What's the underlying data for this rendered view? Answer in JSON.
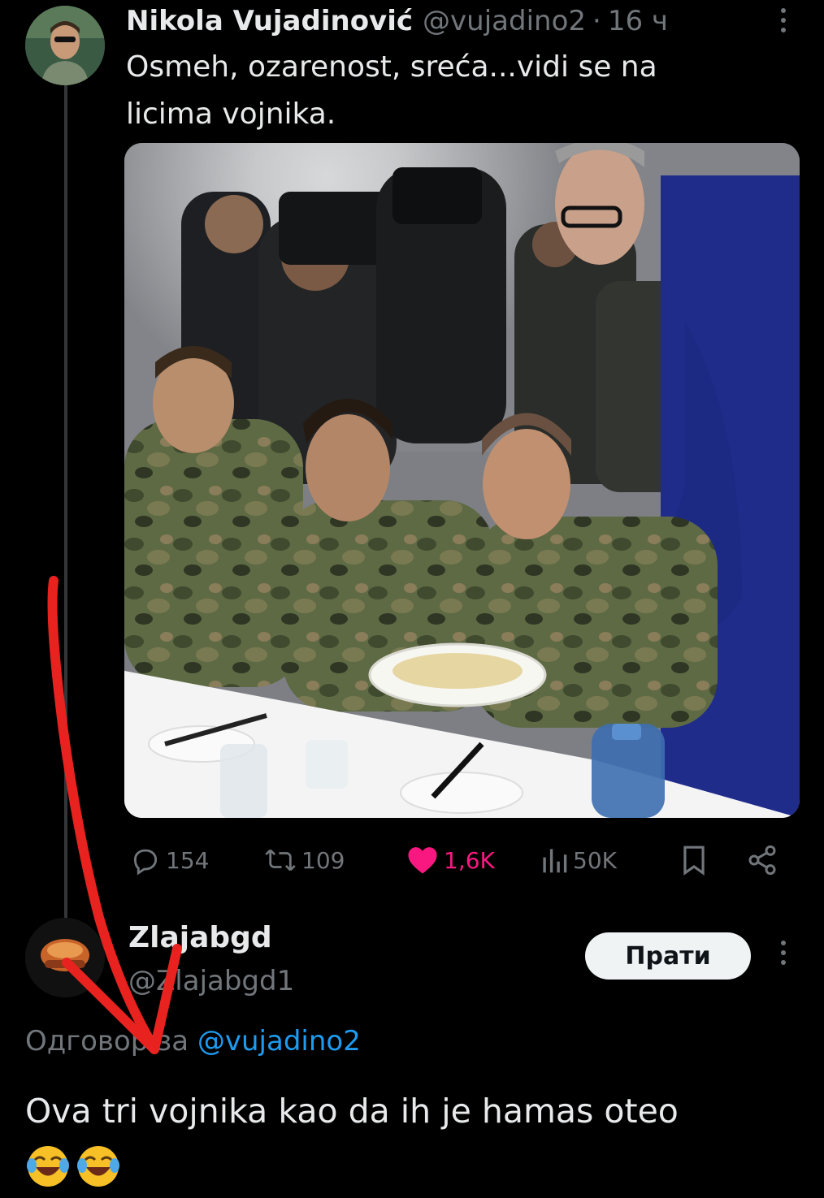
{
  "tweet": {
    "author_name": "Nikola Vujadinović",
    "handle": "@vujadino2",
    "separator": "·",
    "time": "16 ч",
    "text_line1": "Osmeh, ozarenost, sreća...vidi se na",
    "text_line2": "licima vojnika.",
    "metrics": {
      "replies": "154",
      "retweets": "109",
      "likes": "1,6K",
      "views": "50K"
    },
    "like_color": "#f91880"
  },
  "reply": {
    "author_name": "Zlajabgd",
    "handle": "@Zlajabgd1",
    "follow_label": "Прати",
    "reply_to_prefix": "Одговор за",
    "reply_to_handle": "@vujadino2",
    "text": "Ova tri vojnika kao da ih je hamas oteo",
    "emoji": [
      "😂",
      "😂"
    ]
  },
  "colors": {
    "background": "#000000",
    "text_primary": "#e7e9ea",
    "text_secondary": "#71767b",
    "accent": "#1d9bf0",
    "annotation_arrow": "#e8221f"
  },
  "icons": {
    "reply": "reply-icon",
    "retweet": "retweet-icon",
    "like": "heart-icon",
    "views": "views-icon",
    "bookmark": "bookmark-icon",
    "share": "share-icon",
    "more": "more-vertical-icon"
  }
}
